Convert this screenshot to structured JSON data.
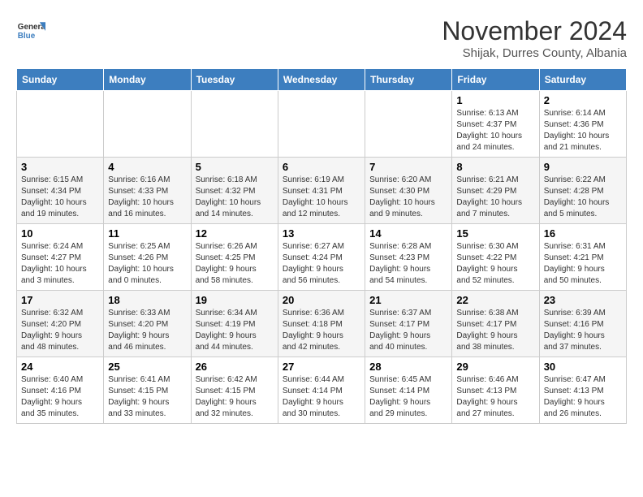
{
  "header": {
    "logo_line1": "General",
    "logo_line2": "Blue",
    "month_year": "November 2024",
    "location": "Shijak, Durres County, Albania"
  },
  "weekdays": [
    "Sunday",
    "Monday",
    "Tuesday",
    "Wednesday",
    "Thursday",
    "Friday",
    "Saturday"
  ],
  "weeks": [
    [
      {
        "day": "",
        "info": ""
      },
      {
        "day": "",
        "info": ""
      },
      {
        "day": "",
        "info": ""
      },
      {
        "day": "",
        "info": ""
      },
      {
        "day": "",
        "info": ""
      },
      {
        "day": "1",
        "info": "Sunrise: 6:13 AM\nSunset: 4:37 PM\nDaylight: 10 hours\nand 24 minutes."
      },
      {
        "day": "2",
        "info": "Sunrise: 6:14 AM\nSunset: 4:36 PM\nDaylight: 10 hours\nand 21 minutes."
      }
    ],
    [
      {
        "day": "3",
        "info": "Sunrise: 6:15 AM\nSunset: 4:34 PM\nDaylight: 10 hours\nand 19 minutes."
      },
      {
        "day": "4",
        "info": "Sunrise: 6:16 AM\nSunset: 4:33 PM\nDaylight: 10 hours\nand 16 minutes."
      },
      {
        "day": "5",
        "info": "Sunrise: 6:18 AM\nSunset: 4:32 PM\nDaylight: 10 hours\nand 14 minutes."
      },
      {
        "day": "6",
        "info": "Sunrise: 6:19 AM\nSunset: 4:31 PM\nDaylight: 10 hours\nand 12 minutes."
      },
      {
        "day": "7",
        "info": "Sunrise: 6:20 AM\nSunset: 4:30 PM\nDaylight: 10 hours\nand 9 minutes."
      },
      {
        "day": "8",
        "info": "Sunrise: 6:21 AM\nSunset: 4:29 PM\nDaylight: 10 hours\nand 7 minutes."
      },
      {
        "day": "9",
        "info": "Sunrise: 6:22 AM\nSunset: 4:28 PM\nDaylight: 10 hours\nand 5 minutes."
      }
    ],
    [
      {
        "day": "10",
        "info": "Sunrise: 6:24 AM\nSunset: 4:27 PM\nDaylight: 10 hours\nand 3 minutes."
      },
      {
        "day": "11",
        "info": "Sunrise: 6:25 AM\nSunset: 4:26 PM\nDaylight: 10 hours\nand 0 minutes."
      },
      {
        "day": "12",
        "info": "Sunrise: 6:26 AM\nSunset: 4:25 PM\nDaylight: 9 hours\nand 58 minutes."
      },
      {
        "day": "13",
        "info": "Sunrise: 6:27 AM\nSunset: 4:24 PM\nDaylight: 9 hours\nand 56 minutes."
      },
      {
        "day": "14",
        "info": "Sunrise: 6:28 AM\nSunset: 4:23 PM\nDaylight: 9 hours\nand 54 minutes."
      },
      {
        "day": "15",
        "info": "Sunrise: 6:30 AM\nSunset: 4:22 PM\nDaylight: 9 hours\nand 52 minutes."
      },
      {
        "day": "16",
        "info": "Sunrise: 6:31 AM\nSunset: 4:21 PM\nDaylight: 9 hours\nand 50 minutes."
      }
    ],
    [
      {
        "day": "17",
        "info": "Sunrise: 6:32 AM\nSunset: 4:20 PM\nDaylight: 9 hours\nand 48 minutes."
      },
      {
        "day": "18",
        "info": "Sunrise: 6:33 AM\nSunset: 4:20 PM\nDaylight: 9 hours\nand 46 minutes."
      },
      {
        "day": "19",
        "info": "Sunrise: 6:34 AM\nSunset: 4:19 PM\nDaylight: 9 hours\nand 44 minutes."
      },
      {
        "day": "20",
        "info": "Sunrise: 6:36 AM\nSunset: 4:18 PM\nDaylight: 9 hours\nand 42 minutes."
      },
      {
        "day": "21",
        "info": "Sunrise: 6:37 AM\nSunset: 4:17 PM\nDaylight: 9 hours\nand 40 minutes."
      },
      {
        "day": "22",
        "info": "Sunrise: 6:38 AM\nSunset: 4:17 PM\nDaylight: 9 hours\nand 38 minutes."
      },
      {
        "day": "23",
        "info": "Sunrise: 6:39 AM\nSunset: 4:16 PM\nDaylight: 9 hours\nand 37 minutes."
      }
    ],
    [
      {
        "day": "24",
        "info": "Sunrise: 6:40 AM\nSunset: 4:16 PM\nDaylight: 9 hours\nand 35 minutes."
      },
      {
        "day": "25",
        "info": "Sunrise: 6:41 AM\nSunset: 4:15 PM\nDaylight: 9 hours\nand 33 minutes."
      },
      {
        "day": "26",
        "info": "Sunrise: 6:42 AM\nSunset: 4:15 PM\nDaylight: 9 hours\nand 32 minutes."
      },
      {
        "day": "27",
        "info": "Sunrise: 6:44 AM\nSunset: 4:14 PM\nDaylight: 9 hours\nand 30 minutes."
      },
      {
        "day": "28",
        "info": "Sunrise: 6:45 AM\nSunset: 4:14 PM\nDaylight: 9 hours\nand 29 minutes."
      },
      {
        "day": "29",
        "info": "Sunrise: 6:46 AM\nSunset: 4:13 PM\nDaylight: 9 hours\nand 27 minutes."
      },
      {
        "day": "30",
        "info": "Sunrise: 6:47 AM\nSunset: 4:13 PM\nDaylight: 9 hours\nand 26 minutes."
      }
    ]
  ]
}
